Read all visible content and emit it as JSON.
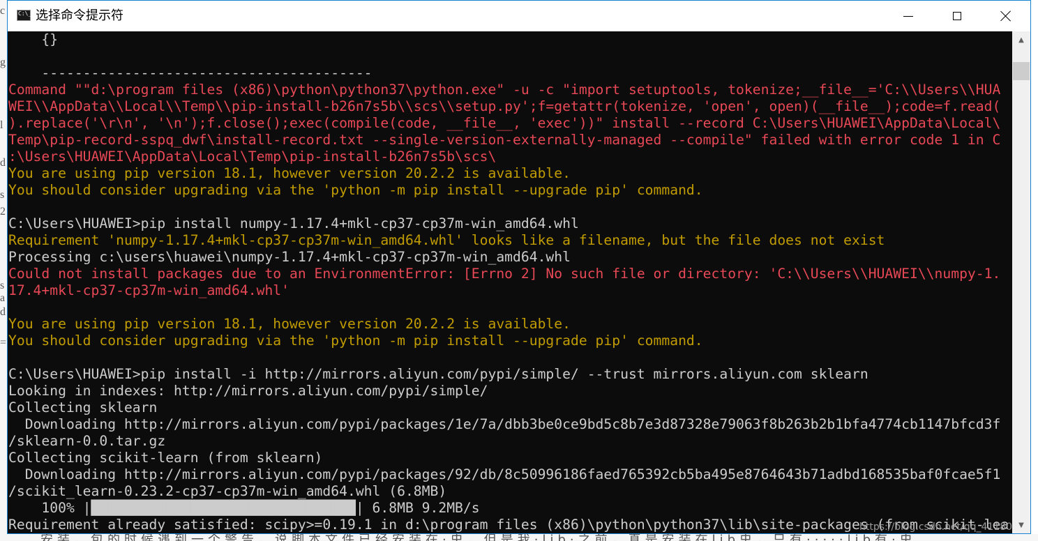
{
  "window": {
    "title": "选择命令提示符",
    "icon": "console-icon",
    "minimize_icon": "minimize-icon",
    "maximize_icon": "maximize-icon",
    "close_icon": "close-icon"
  },
  "colors": {
    "console_bg": "#0c0c0c",
    "default_text": "#cccccc",
    "error_text": "#e74856",
    "warning_text": "#c19c00",
    "title_bar": "#ffffff",
    "window_border": "#1383d2"
  },
  "console": {
    "lines": [
      {
        "text": "    {}",
        "color": "default"
      },
      {
        "text": "",
        "color": "default"
      },
      {
        "text": "    ----------------------------------------",
        "color": "default"
      },
      {
        "text": "Command \"\"d:\\program files (x86)\\python\\python37\\python.exe\" -u -c \"import setuptools, tokenize;__file__='C:\\\\Users\\\\HUA",
        "color": "red"
      },
      {
        "text": "WEI\\\\AppData\\\\Local\\\\Temp\\\\pip-install-b26n7s5b\\\\scs\\\\setup.py';f=getattr(tokenize, 'open', open)(__file__);code=f.read(",
        "color": "red"
      },
      {
        "text": ").replace('\\r\\n', '\\n');f.close();exec(compile(code, __file__, 'exec'))\" install --record C:\\Users\\HUAWEI\\AppData\\Local\\",
        "color": "red"
      },
      {
        "text": "Temp\\pip-record-sspq_dwf\\install-record.txt --single-version-externally-managed --compile\" failed with error code 1 in C",
        "color": "red"
      },
      {
        "text": ":\\Users\\HUAWEI\\AppData\\Local\\Temp\\pip-install-b26n7s5b\\scs\\",
        "color": "red"
      },
      {
        "text": "You are using pip version 18.1, however version 20.2.2 is available.",
        "color": "yellow"
      },
      {
        "text": "You should consider upgrading via the 'python -m pip install --upgrade pip' command.",
        "color": "yellow"
      },
      {
        "text": "",
        "color": "default"
      },
      {
        "text": "C:\\Users\\HUAWEI>pip install numpy-1.17.4+mkl-cp37-cp37m-win_amd64.whl",
        "color": "default"
      },
      {
        "text": "Requirement 'numpy-1.17.4+mkl-cp37-cp37m-win_amd64.whl' looks like a filename, but the file does not exist",
        "color": "yellow"
      },
      {
        "text": "Processing c:\\users\\huawei\\numpy-1.17.4+mkl-cp37-cp37m-win_amd64.whl",
        "color": "default"
      },
      {
        "text": "Could not install packages due to an EnvironmentError: [Errno 2] No such file or directory: 'C:\\\\Users\\\\HUAWEI\\\\numpy-1.",
        "color": "red"
      },
      {
        "text": "17.4+mkl-cp37-cp37m-win_amd64.whl'",
        "color": "red"
      },
      {
        "text": "",
        "color": "default"
      },
      {
        "text": "You are using pip version 18.1, however version 20.2.2 is available.",
        "color": "yellow"
      },
      {
        "text": "You should consider upgrading via the 'python -m pip install --upgrade pip' command.",
        "color": "yellow"
      },
      {
        "text": "",
        "color": "default"
      },
      {
        "text": "C:\\Users\\HUAWEI>pip install -i http://mirrors.aliyun.com/pypi/simple/ --trust mirrors.aliyun.com sklearn",
        "color": "default"
      },
      {
        "text": "Looking in indexes: http://mirrors.aliyun.com/pypi/simple/",
        "color": "default"
      },
      {
        "text": "Collecting sklearn",
        "color": "default"
      },
      {
        "text": "  Downloading http://mirrors.aliyun.com/pypi/packages/1e/7a/dbb3be0ce9bd5c8b7e3d87328e79063f8b263b2b1bfa4774cb1147bfcd3f",
        "color": "default"
      },
      {
        "text": "/sklearn-0.0.tar.gz",
        "color": "default"
      },
      {
        "text": "Collecting scikit-learn (from sklearn)",
        "color": "default"
      },
      {
        "text": "  Downloading http://mirrors.aliyun.com/pypi/packages/92/db/8c50996186faed765392cb5ba495e8764643b71adbd168535baf0fcae5f1",
        "color": "default"
      },
      {
        "text": "/scikit_learn-0.23.2-cp37-cp37m-win_amd64.whl (6.8MB)",
        "color": "default"
      },
      {
        "text": "    100% |████████████████████████████████| 6.8MB 9.2MB/s",
        "color": "default"
      },
      {
        "text": "Requirement already satisfied: scipy>=0.19.1 in d:\\program files (x86)\\python\\python37\\lib\\site-packages (from scikit-lea",
        "color": "default"
      }
    ]
  },
  "scrollbar": {
    "up_arrow": "▲",
    "down_arrow": "▼"
  },
  "watermark": "https://blog.csdn.net/qq_41180",
  "background": {
    "left_glyphs": [
      "c",
      "g",
      "l",
      "d",
      "s",
      "2",
      "s",
      "a",
      "d",
      "="
    ],
    "bottom_text": "安装，包的时候遇到一个警告，说脚本文件已经安装在·虫，但是我·lib·之前，真是安装在lib虫，只有·····lib有·虫"
  }
}
